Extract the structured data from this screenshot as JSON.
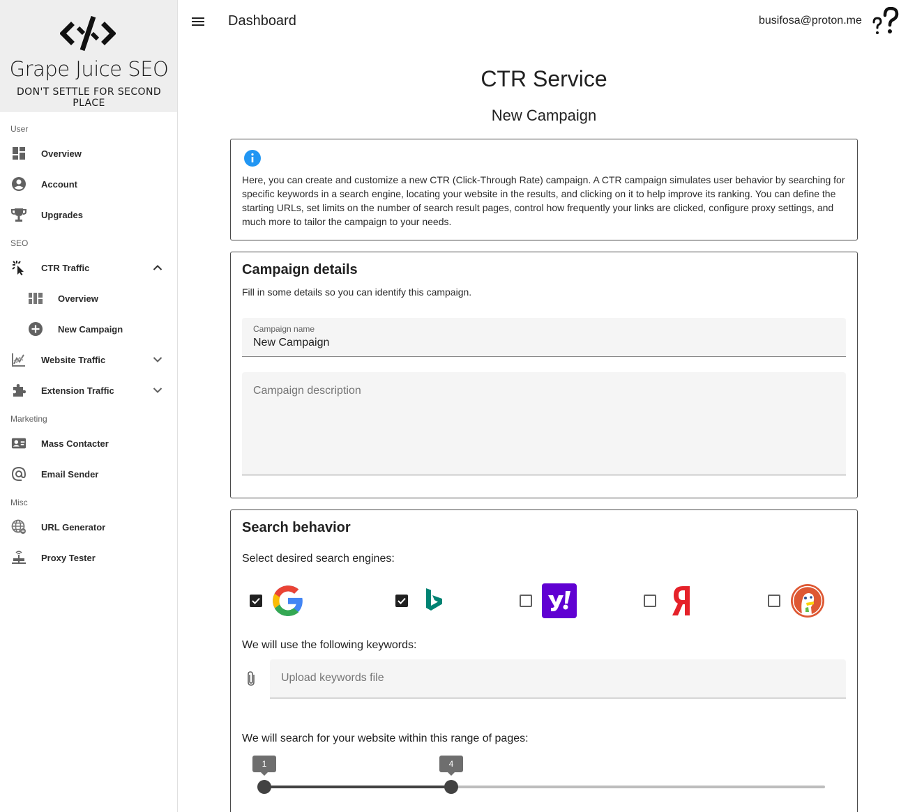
{
  "brand": {
    "name": "Grape Juice SEO",
    "tagline": "DON'T SETTLE FOR SECOND PLACE"
  },
  "sidebar": {
    "sections": {
      "user": "User",
      "seo": "SEO",
      "marketing": "Marketing",
      "misc": "Misc"
    },
    "items": [
      {
        "label": "Overview",
        "icon": "dashboard-icon"
      },
      {
        "label": "Account",
        "icon": "account-circle-icon"
      },
      {
        "label": "Upgrades",
        "icon": "trophy-icon"
      },
      {
        "label": "CTR Traffic",
        "icon": "click-cursor-icon",
        "expanded": true
      },
      {
        "label": "Overview",
        "icon": "grid-view-icon"
      },
      {
        "label": "New Campaign",
        "icon": "add-circle-icon"
      },
      {
        "label": "Website Traffic",
        "icon": "trending-chart-icon",
        "expanded": false
      },
      {
        "label": "Extension Traffic",
        "icon": "puzzle-icon",
        "expanded": false
      },
      {
        "label": "Mass Contacter",
        "icon": "contact-card-icon"
      },
      {
        "label": "Email Sender",
        "icon": "at-sign-icon"
      },
      {
        "label": "URL Generator",
        "icon": "globe-link-icon"
      },
      {
        "label": "Proxy Tester",
        "icon": "network-icon"
      }
    ]
  },
  "header": {
    "title": "Dashboard",
    "user_email": "busifosa@proton.me"
  },
  "page": {
    "title": "CTR Service",
    "subtitle": "New Campaign"
  },
  "info": {
    "text": "Here, you can create and customize a new CTR (Click-Through Rate) campaign. A CTR campaign simulates user behavior by searching for specific keywords in a search engine, locating your website in the results, and clicking on it to help improve its ranking. You can define the starting URLs, set limits on the number of search result pages, control how frequently your links are clicked, configure proxy settings, and much more to tailor the campaign to your needs."
  },
  "details": {
    "title": "Campaign details",
    "description": "Fill in some details so you can identify this campaign.",
    "name_label": "Campaign name",
    "name_value": "New Campaign",
    "desc_placeholder": "Campaign description"
  },
  "search": {
    "title": "Search behavior",
    "engines_prompt": "Select desired search engines:",
    "engines": [
      {
        "name": "google",
        "checked": true
      },
      {
        "name": "bing",
        "checked": true
      },
      {
        "name": "yahoo",
        "checked": false
      },
      {
        "name": "yandex",
        "checked": false
      },
      {
        "name": "duckduckgo",
        "checked": false
      }
    ],
    "keywords_prompt": "We will use the following keywords:",
    "upload_placeholder": "Upload keywords file",
    "range_prompt": "We will search for your website within this range of pages:",
    "range": {
      "min": 1,
      "max": 10,
      "low": 1,
      "high": 4,
      "low_label": "1",
      "high_label": "4"
    }
  },
  "colors": {
    "accent": "#212121",
    "info_blue": "#2196f3",
    "yahoo_purple": "#6001d2",
    "yandex_red": "#fc3f1d",
    "ddg_orange": "#de5833",
    "bing_teal": "#008373"
  }
}
